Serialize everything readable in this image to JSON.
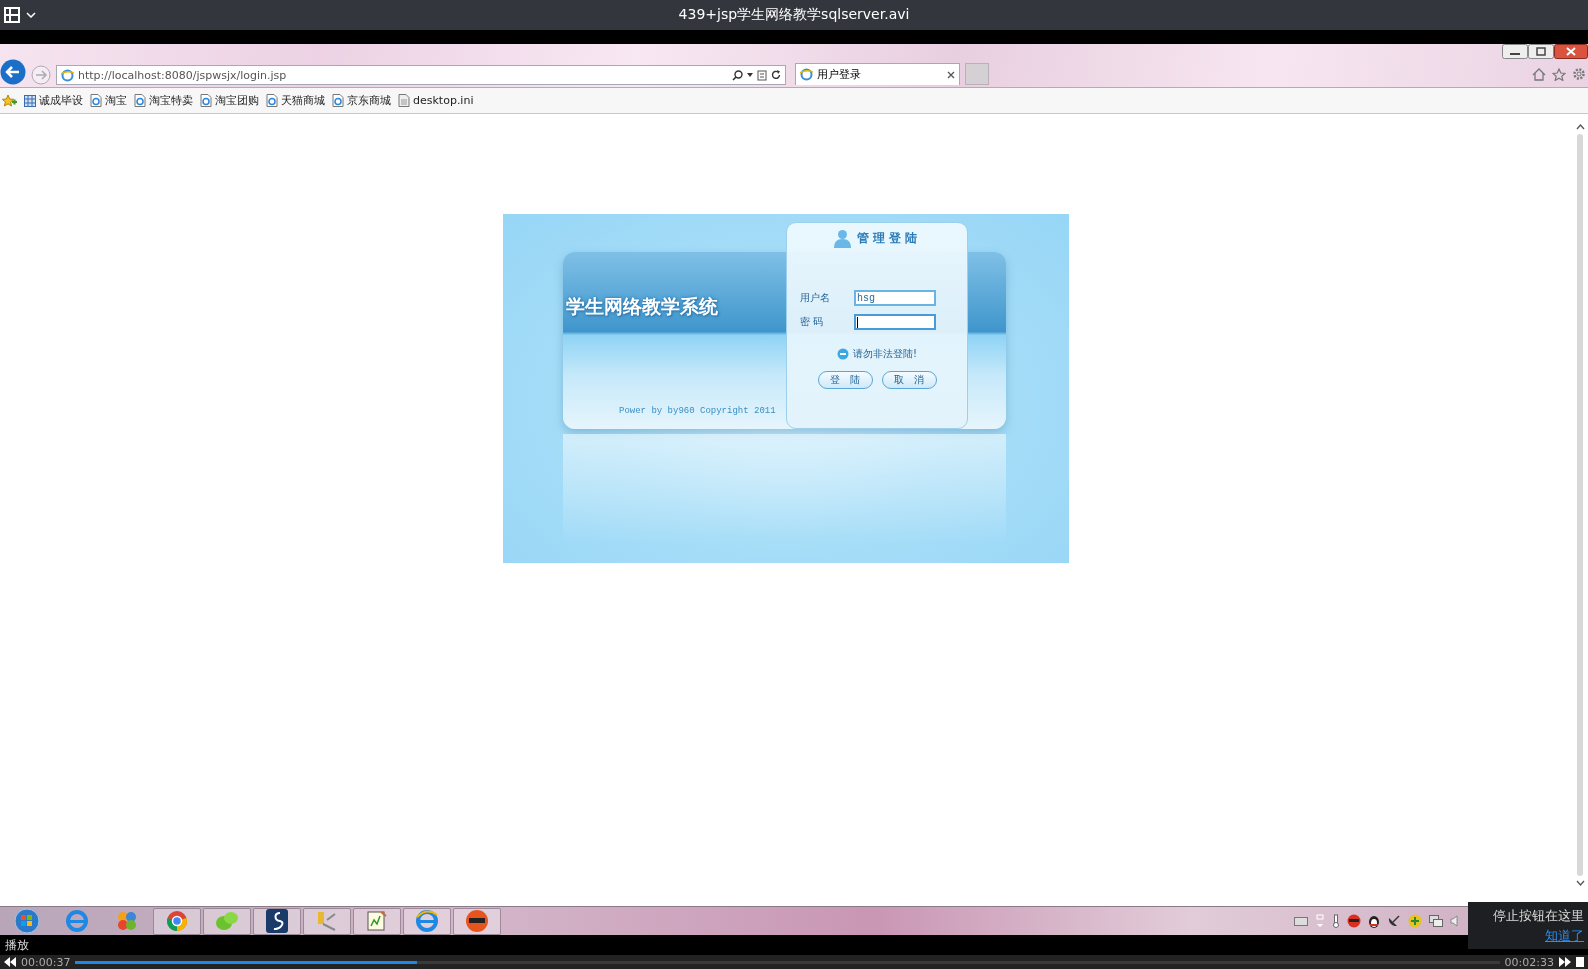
{
  "player": {
    "title": "439+jsp学生网络教学sqlserver.avi",
    "status": "播放",
    "elapsed": "00:00:37",
    "total": "00:02:33",
    "level": 0.24,
    "tooltip": {
      "text": "停止按钮在这里",
      "link": "知道了"
    }
  },
  "browser": {
    "url": "http://localhost:8080/jspwsjx/login.jsp",
    "tab_title": "用户登录",
    "bookmarks": [
      {
        "kind": "grid",
        "label": "诚成毕设"
      },
      {
        "kind": "page",
        "label": "淘宝"
      },
      {
        "kind": "page",
        "label": "淘宝特卖"
      },
      {
        "kind": "page",
        "label": "淘宝团购"
      },
      {
        "kind": "page",
        "label": "天猫商城"
      },
      {
        "kind": "page",
        "label": "京东商城"
      },
      {
        "kind": "file",
        "label": "desktop.ini"
      }
    ]
  },
  "login": {
    "system_title": "学生网络教学系统",
    "panel_title": "管理登陆",
    "fields": [
      {
        "label": "用户名",
        "value": "hsg"
      },
      {
        "label": "密 码",
        "focused": true
      }
    ],
    "notice": "请勿非法登陆!",
    "buttons": [
      "登陆",
      "取消"
    ],
    "copyright": "Power by by960 Copyright 2011"
  }
}
